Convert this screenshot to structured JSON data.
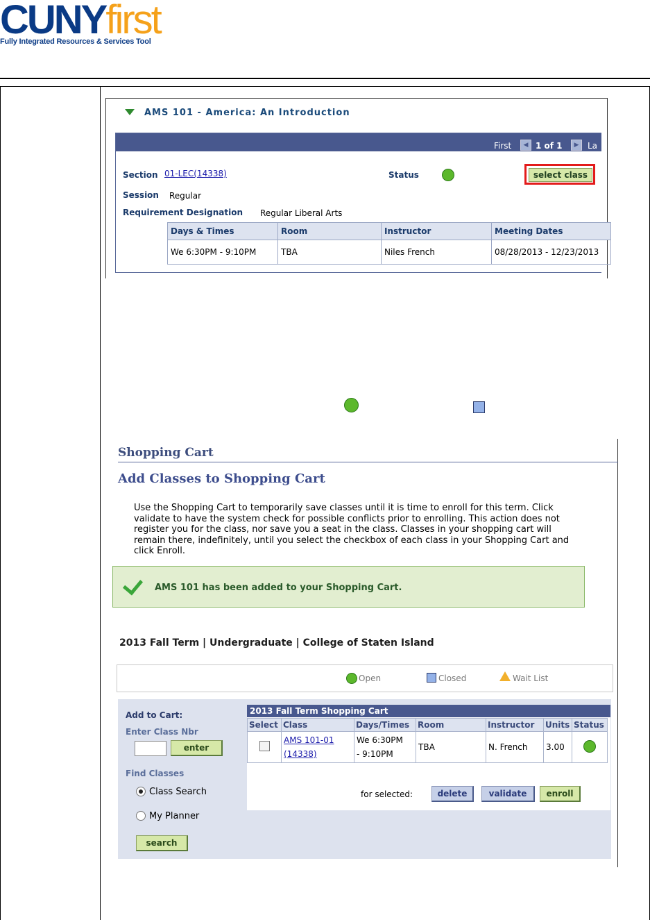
{
  "header": {
    "logo_cuny": "CUNY",
    "logo_first": "first",
    "logo_tagline": "Fully Integrated Resources & Services Tool"
  },
  "class_details": {
    "title": "AMS  101 - America: An Introduction",
    "nav": {
      "first": "First",
      "count": "1 of 1",
      "last": "La"
    },
    "section_label": "Section",
    "section_value": "01-LEC(14338)",
    "status_label": "Status",
    "session_label": "Session",
    "session_value": "Regular",
    "requirement_label": "Requirement Designation",
    "requirement_value": "Regular Liberal Arts",
    "select_button": "select class",
    "meeting_headers": [
      "Days & Times",
      "Room",
      "Instructor",
      "Meeting Dates"
    ],
    "meeting_row": {
      "days_times": "We 6:30PM - 9:10PM",
      "room": "TBA",
      "instructor": "Niles French",
      "dates": "08/28/2013 - 12/23/2013"
    }
  },
  "legend_icons": {
    "open_color": "#5cb82c",
    "closed_color": "#94b2e8"
  },
  "shopping_cart": {
    "title": "Shopping Cart",
    "subtitle": "Add Classes to Shopping Cart",
    "description": "Use the Shopping Cart to temporarily save classes until it is time to enroll for this term. Click validate to have the system check for possible conflicts prior to enrolling. This action does not register you for the class, nor save you a seat in the class. Classes in your shopping cart will remain there, indefinitely, until you select the checkbox of each class in your Shopping Cart and click Enroll.",
    "success_message": "AMS  101 has been added to your Shopping Cart.",
    "term_line": "2013 Fall Term | Undergraduate | College of Staten Island",
    "legend": {
      "open": "Open",
      "closed": "Closed",
      "wait_list": "Wait List"
    },
    "add_to_cart_label": "Add to Cart:",
    "enter_class_nbr_label": "Enter Class Nbr",
    "class_nbr_value": "",
    "enter_button": "enter",
    "find_classes_label": "Find Classes",
    "radio_class_search": "Class Search",
    "radio_my_planner": "My Planner",
    "search_button": "search",
    "cart_table_title": "2013 Fall Term Shopping Cart",
    "cart_headers": [
      "Select",
      "Class",
      "Days/Times",
      "Room",
      "Instructor",
      "Units",
      "Status"
    ],
    "cart_row": {
      "class_line1": "AMS 101-01",
      "class_line2": "(14338)",
      "days_line1": "We 6:30PM",
      "days_line2": "- 9:10PM",
      "room": "TBA",
      "instructor": "N. French",
      "units": "3.00"
    },
    "for_selected_label": "for selected:",
    "delete_button": "delete",
    "validate_button": "validate",
    "enroll_button": "enroll"
  }
}
